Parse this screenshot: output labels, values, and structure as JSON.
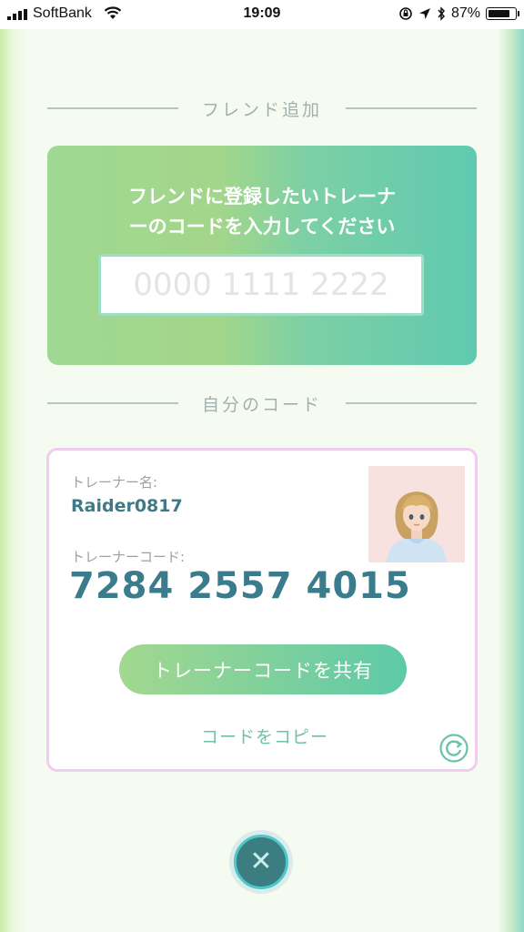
{
  "status_bar": {
    "carrier": "SoftBank",
    "time": "19:09",
    "battery_percent": "87%",
    "battery_level": 0.87,
    "icons": [
      "signal-icon",
      "wifi-icon",
      "rotation-lock-icon",
      "location-icon",
      "bluetooth-icon",
      "battery-icon"
    ]
  },
  "add_friend": {
    "header": "フレンド追加",
    "instruction_line1": "フレンドに登録したいトレーナ",
    "instruction_line2": "ーのコードを入力してください",
    "input_value": "",
    "input_placeholder": "0000 1111 2222"
  },
  "my_code": {
    "header": "自分のコード",
    "name_label": "トレーナー名:",
    "name_value": "Raider0817",
    "code_label": "トレーナーコード:",
    "code_value": "7284 2557 4015",
    "share_label": "トレーナーコードを共有",
    "copy_label": "コードをコピー"
  },
  "colors": {
    "accent": "#3b7c8c",
    "panel_gradient_start": "#9fd893",
    "panel_gradient_end": "#5fc9b0",
    "card_border": "#efcdee"
  }
}
